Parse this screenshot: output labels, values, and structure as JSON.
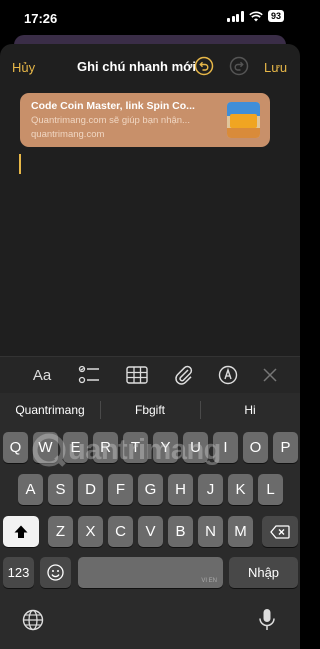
{
  "status": {
    "time": "17:26",
    "battery": "93"
  },
  "nav": {
    "cancel": "Hủy",
    "title": "Ghi chú nhanh mới",
    "save": "Lưu"
  },
  "link_card": {
    "title": "Code Coin Master, link Spin Co...",
    "description": "Quantrimang.com sẽ giúp bạn nhận...",
    "domain": "quantrimang.com"
  },
  "toolbar": {
    "format_label": "Aa"
  },
  "suggestions": [
    "Quantrimang",
    "Fbgift",
    "Hi"
  ],
  "keyboard": {
    "row1": [
      "Q",
      "W",
      "E",
      "R",
      "T",
      "Y",
      "U",
      "I",
      "O",
      "P"
    ],
    "row2": [
      "A",
      "S",
      "D",
      "F",
      "G",
      "H",
      "J",
      "K",
      "L"
    ],
    "row3": [
      "Z",
      "X",
      "C",
      "V",
      "B",
      "N",
      "M"
    ],
    "numbers_key": "123",
    "space_hint": "VI EN",
    "return_key": "Nhập"
  },
  "watermark": "uantrimang",
  "colors": {
    "accent": "#e7b748",
    "card": "#c8906a",
    "sheet": "#1f1f1f",
    "key": "#6b6b6b"
  }
}
